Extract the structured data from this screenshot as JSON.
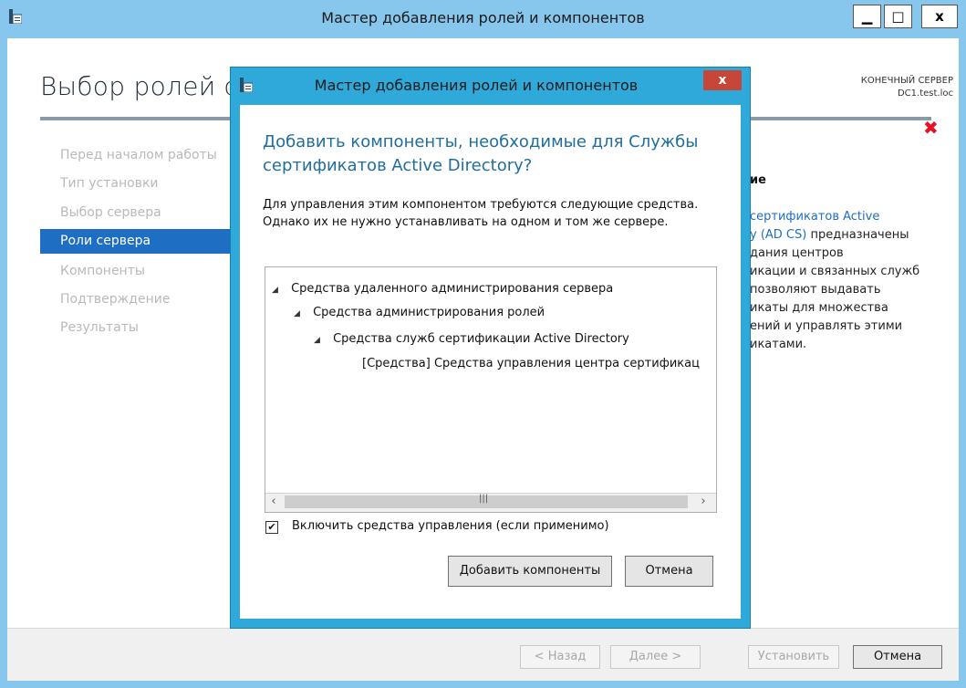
{
  "outer_window": {
    "title": "Мастер добавления ролей и компонентов",
    "controls": {
      "minimize": "▁",
      "maximize": "□",
      "close": "x"
    },
    "heading": "Выбор ролей с",
    "destination_label": "КОНЕЧНЫЙ СЕРВЕР",
    "destination_server": "DC1.test.loc",
    "nav": [
      "Перед началом работы",
      "Тип установки",
      "Выбор сервера",
      "Роли сервера",
      "Компоненты",
      "Подтверждение",
      "Результаты"
    ],
    "nav_active_index": 3,
    "description_title": "ие",
    "description_lines": [
      {
        "link": "сертификатов Active",
        "text": ""
      },
      {
        "link": "y (AD CS)",
        "text": " предназначены"
      },
      {
        "link": "",
        "text": "дания центров"
      },
      {
        "link": "",
        "text": "икации и связанных служб"
      },
      {
        "link": "",
        "text": " позволяют выдавать"
      },
      {
        "link": "",
        "text": "икаты для множества"
      },
      {
        "link": "",
        "text": "ений и управлять этими"
      },
      {
        "link": "",
        "text": "икатами."
      }
    ],
    "buttons": {
      "back": "< Назад",
      "next": "Далее >",
      "install": "Установить",
      "cancel": "Отмена"
    }
  },
  "dialog": {
    "title": "Мастер добавления ролей и компонентов",
    "close": "x",
    "heading": "Добавить компоненты, необходимые для Службы сертификатов Active Directory?",
    "text": "Для управления этим компонентом требуются следующие средства. Однако их не нужно устанавливать на одном и том же сервере.",
    "tree": [
      {
        "level": 0,
        "expander": "◢",
        "label": "Средства удаленного администрирования сервера"
      },
      {
        "level": 1,
        "expander": "◢",
        "label": "Средства администрирования ролей"
      },
      {
        "level": 2,
        "expander": "◢",
        "label": "Средства служб сертификации Active Directory"
      },
      {
        "level": 3,
        "expander": "",
        "label": "[Средства] Средства управления центра сертификац"
      }
    ],
    "checkbox_label": "Включить средства управления (если применимо)",
    "checkbox_checked": true,
    "add_button": "Добавить компоненты",
    "cancel_button": "Отмена"
  }
}
